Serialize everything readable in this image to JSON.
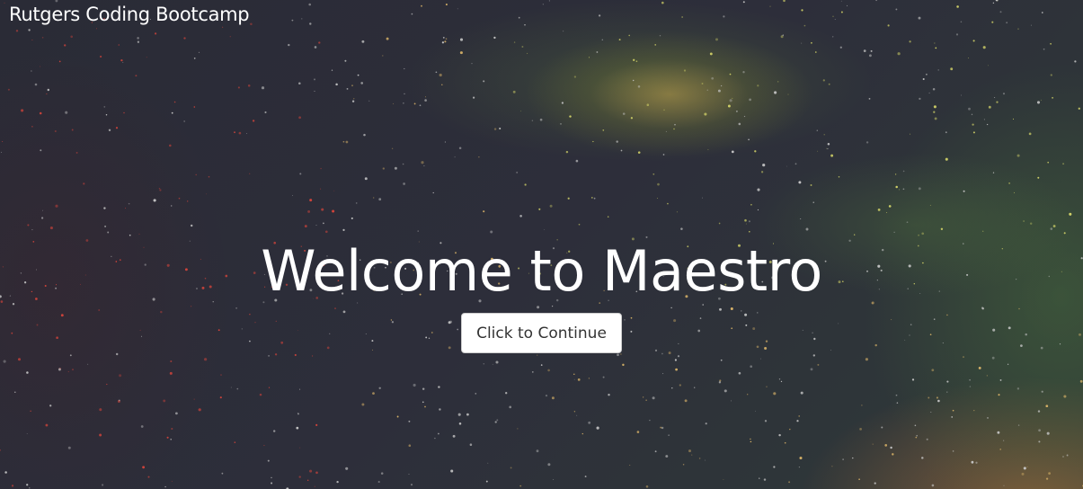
{
  "header": {
    "brand": "Rutgers Coding Bootcamp"
  },
  "hero": {
    "title": "Welcome to Maestro",
    "button_label": "Click to Continue"
  },
  "colors": {
    "background": "#2b2c38",
    "text": "#ffffff",
    "button_bg": "#ffffff",
    "button_text": "#333333"
  }
}
